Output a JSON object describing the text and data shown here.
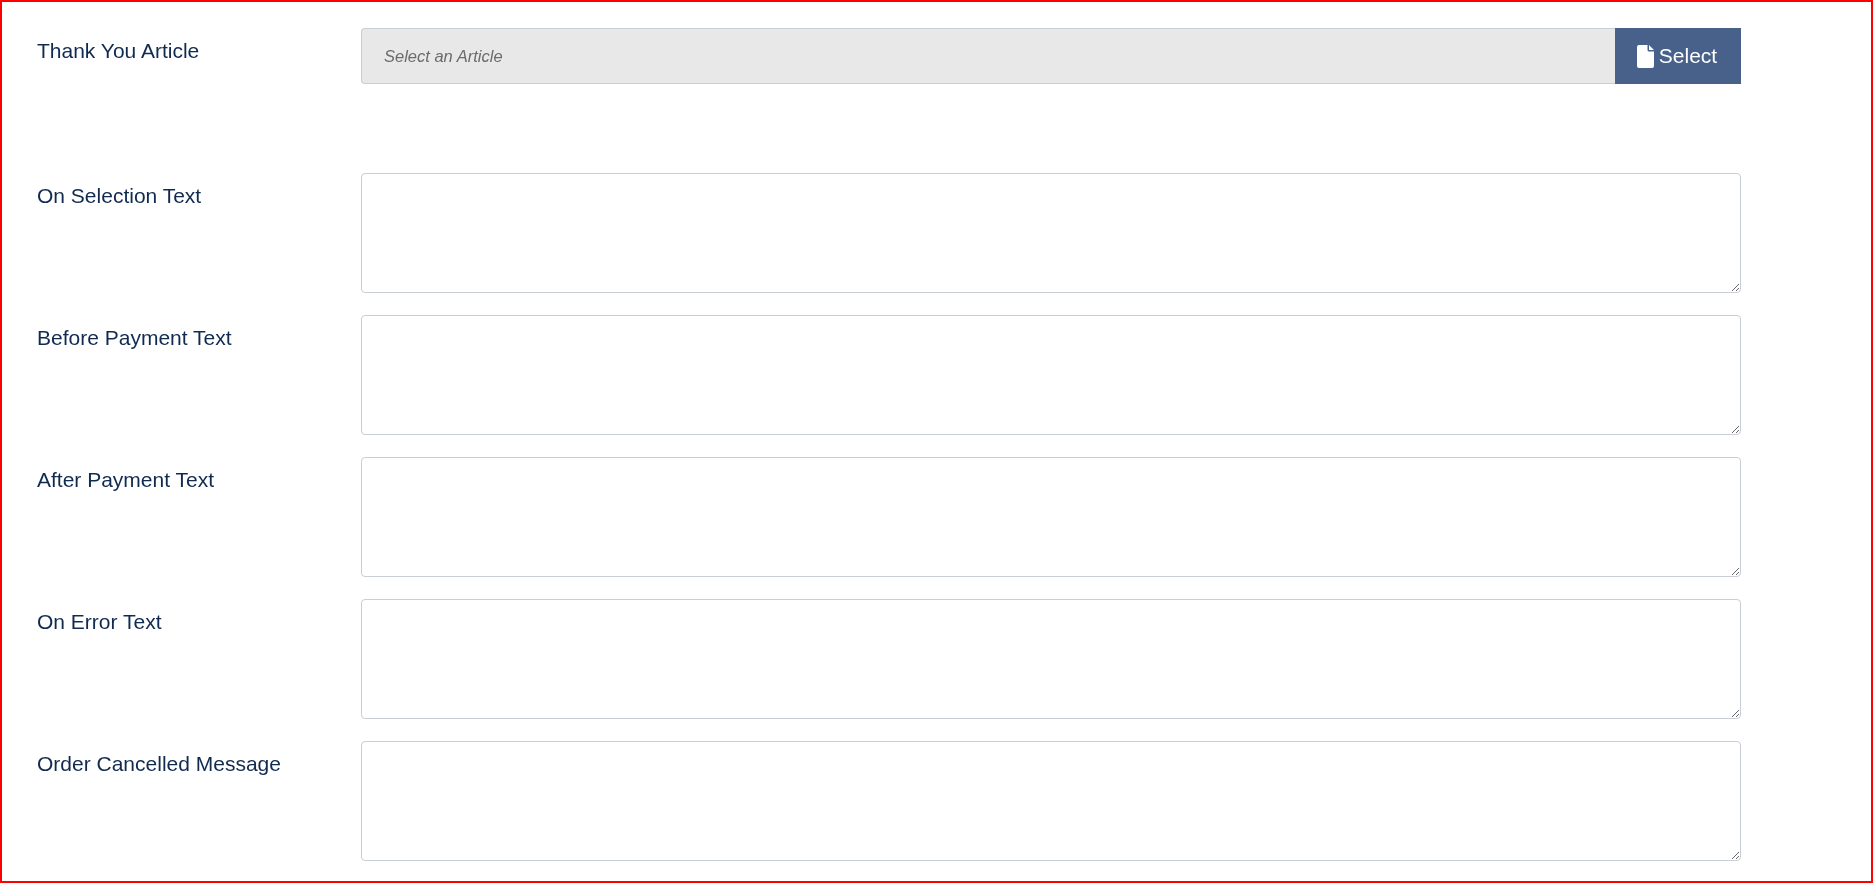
{
  "article_field": {
    "label": "Thank You Article",
    "placeholder": "Select an Article",
    "button": "Select"
  },
  "text_fields": [
    {
      "label": "On Selection Text"
    },
    {
      "label": "Before Payment Text"
    },
    {
      "label": "After Payment Text"
    },
    {
      "label": "On Error Text"
    },
    {
      "label": "Order Cancelled Message"
    }
  ]
}
